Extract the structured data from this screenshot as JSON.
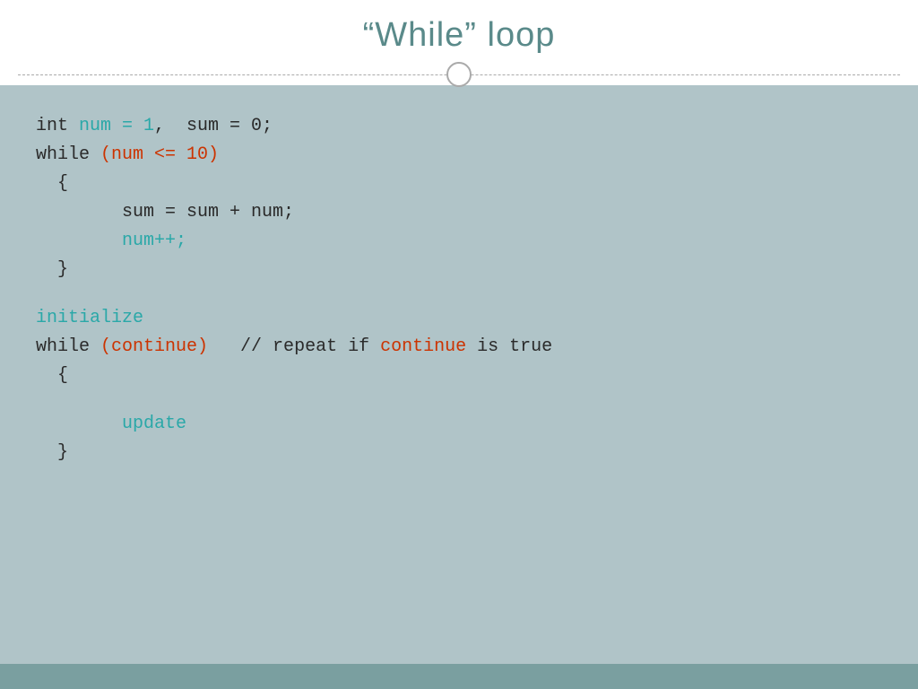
{
  "header": {
    "title": "“While” loop"
  },
  "code": {
    "line1": "int ",
    "line1_cyan": "num = 1",
    "line1_rest": ",  sum = 0;",
    "line2_kw": "while",
    "line2_red": "(num <= 10)",
    "line3": "  {",
    "line4": "        sum = sum + num;",
    "line5_cyan": "        num++;",
    "line6": "  }",
    "line7_cyan": "initialize",
    "line8_kw": "while",
    "line8_red": "(continue)",
    "line8_rest": "   // repeat if ",
    "line8_red2": "continue",
    "line8_end": " is true",
    "line9": "  {",
    "line10_cyan": "        update",
    "line11": "  }"
  }
}
